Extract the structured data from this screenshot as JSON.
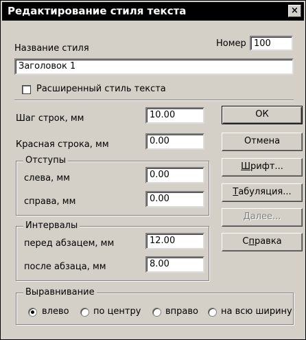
{
  "window": {
    "title": "Редактирование стиля текста",
    "close_label": "×"
  },
  "style_name": {
    "label": "Название стиля",
    "value": "Заголовок 1"
  },
  "number": {
    "label": "Номер",
    "value": "100"
  },
  "extended_style": {
    "label": "Расширенный стиль текста",
    "checked": false
  },
  "line_step": {
    "label": "Шаг строк, мм",
    "value": "10.00"
  },
  "first_line": {
    "label": "Красная строка, мм",
    "value": "0.00"
  },
  "indents": {
    "title": "Отступы",
    "left_label": "слева, мм",
    "left_value": "0.00",
    "right_label": "справа, мм",
    "right_value": "0.00"
  },
  "intervals": {
    "title": "Интервалы",
    "before_label": "перед абзацем, мм",
    "before_value": "12.00",
    "after_label": "после абзаца, мм",
    "after_value": "8.00"
  },
  "alignment": {
    "title": "Выравнивание",
    "options": [
      "влево",
      "по центру",
      "вправо",
      "на всю ширину"
    ],
    "selected": "влево"
  },
  "buttons": {
    "ok": "ОК",
    "cancel": "Отмена",
    "font_key": "Ш",
    "font_rest": "рифт...",
    "tabs_key": "Т",
    "tabs_rest": "абуляция...",
    "more": "Далее...",
    "help_prefix": "С",
    "help_key": "п",
    "help_rest": "равка"
  }
}
